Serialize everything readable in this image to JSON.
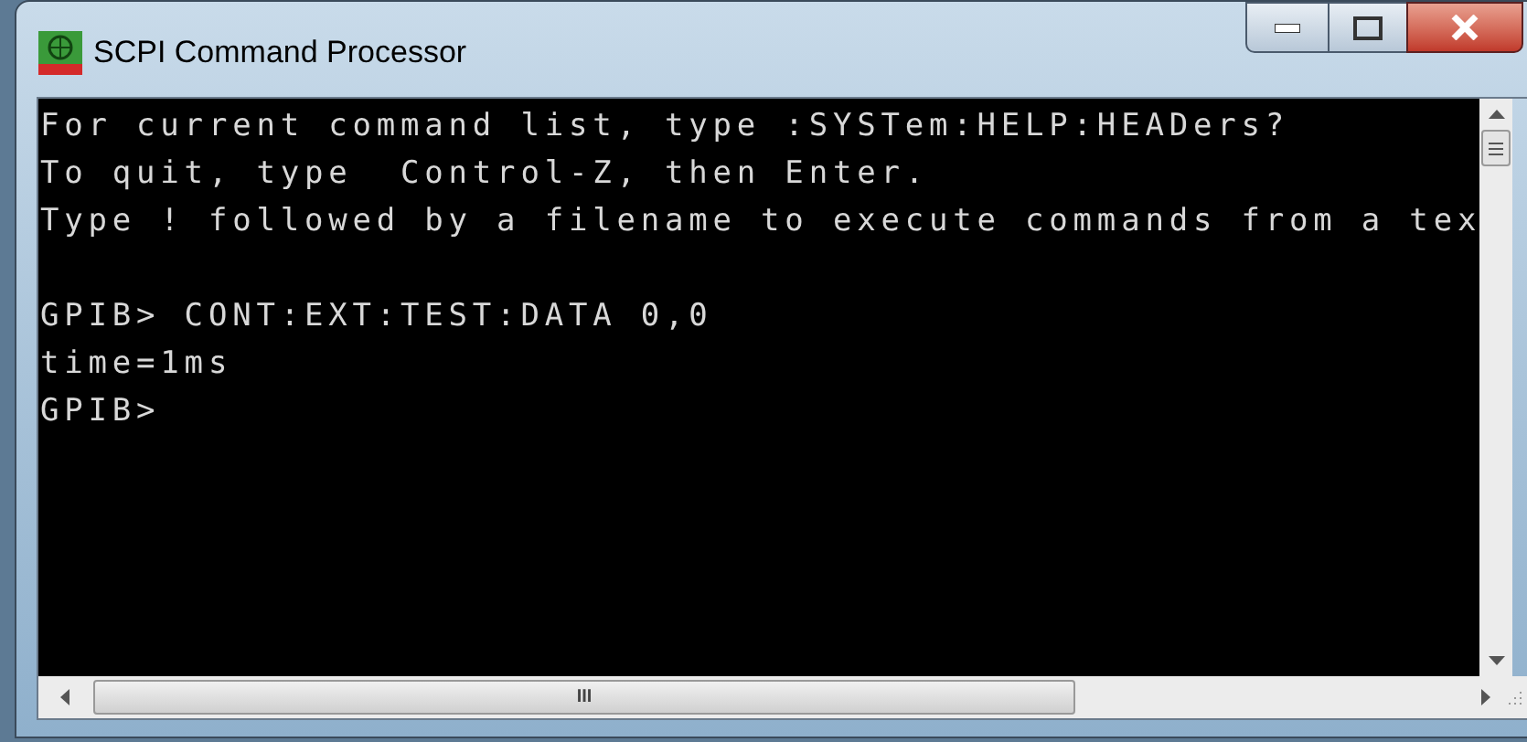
{
  "window": {
    "title": "SCPI Command Processor"
  },
  "console": {
    "help_lines": [
      "For current command list, type :SYSTem:HELP:HEADers?",
      "To quit, type  Control-Z, then Enter.",
      "Type ! followed by a filename to execute commands from a tex"
    ],
    "session_lines": [
      "GPIB> CONT:EXT:TEST:DATA 0,0",
      "time=1ms",
      "GPIB>"
    ]
  },
  "scrollbar_grip": "III"
}
